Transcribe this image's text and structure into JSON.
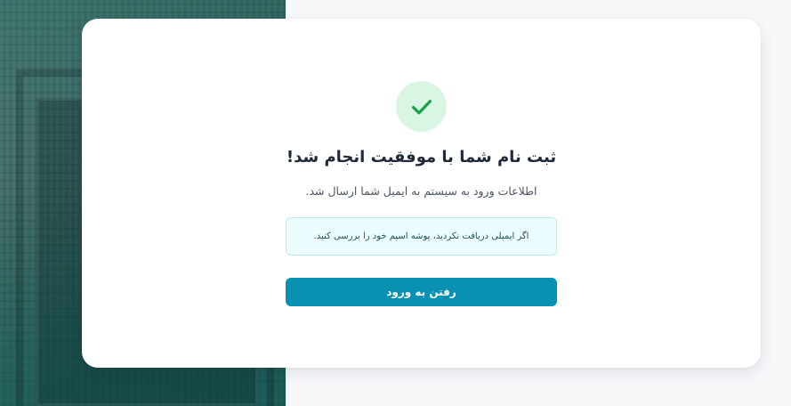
{
  "background": {
    "icon": "carved-stone-relief-image",
    "overlay_color": "#1e5f5a"
  },
  "card": {
    "success_icon": "check-icon",
    "success_icon_color": "#16a34a",
    "success_icon_bg": "#d8f6e3",
    "title": "ثبت نام شما با موفقیت انجام شد!",
    "subtitle": "اطلاعات ورود به سیستم به ایمیل شما ارسال شد.",
    "notice": "اگر ایمیلی دریافت نکردید، پوشه اسپم خود را بررسی کنید.",
    "login_button_label": "رفتن به ورود",
    "accent_color": "#0891b2"
  }
}
